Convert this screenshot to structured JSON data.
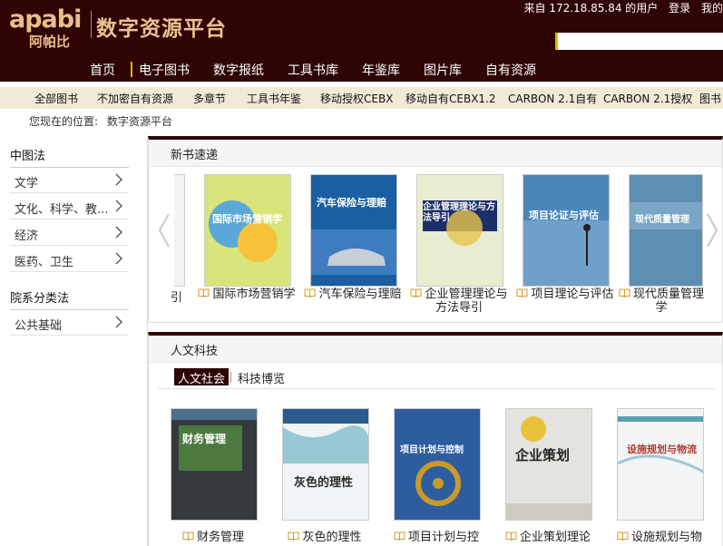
{
  "header": {
    "logo_en": "apabi",
    "logo_cn": "阿帕比",
    "site_title": "数字资源平台",
    "user_text": "来自 172.18.85.84 的用户",
    "login": "登录",
    "mine": "我的",
    "search_value": ""
  },
  "main_nav": [
    "首页",
    "电子图书",
    "数字报纸",
    "工具书库",
    "年鉴库",
    "图片库",
    "自有资源"
  ],
  "sub_nav": [
    "全部图书",
    "不加密自有资源",
    "多章节",
    "工具书年鉴",
    "移动授权CEBX",
    "移动自有CEBX1.2",
    "CARBON 2.1自有",
    "CARBON 2.1授权",
    "图书"
  ],
  "breadcrumb": {
    "label": "您现在的位置:",
    "current": "数字资源平台"
  },
  "sidebar": {
    "heading1": "中图法",
    "items1": [
      "文学",
      "文化、科学、教...",
      "经济",
      "医药、卫生"
    ],
    "heading2": "院系分类法",
    "items2": [
      "公共基础"
    ]
  },
  "new_books": {
    "title": "新书速递",
    "partial_caption": "引",
    "books": [
      {
        "title": "国际市场营销学",
        "cover_text": "国际市场营销学",
        "color": "#d8e57a"
      },
      {
        "title": "汽车保险与理赔",
        "cover_text": "汽车保险与理赔",
        "color": "#1b5fa3"
      },
      {
        "title": "企业管理理论与方法导引",
        "cover_text": "企业管理理论与方法导引",
        "color": "#e9ecd0"
      },
      {
        "title": "项目理论与评估",
        "cover_text": "项目论证与评估",
        "color": "#4a86b9"
      },
      {
        "title": "现代质量管理学",
        "cover_text": "现代质量管理",
        "color": "#5d8fb3"
      }
    ]
  },
  "humanities": {
    "title": "人文科技",
    "tabs": [
      "人文社会",
      "科技博览"
    ],
    "books": [
      {
        "title": "财务管理",
        "cover_text": "财务管理",
        "color": "#343a3e"
      },
      {
        "title": "灰色的理性",
        "cover_text": "灰色的理性",
        "color": "#f1f4f6"
      },
      {
        "title": "项目计划与控",
        "cover_text": "项目计划与控制",
        "color": "#2d5d9e"
      },
      {
        "title": "企业策划理论",
        "cover_text": "企业策划",
        "color": "#e5e3e0"
      },
      {
        "title": "设施规划与物",
        "cover_text": "设施规划与物流",
        "color": "#f2f4f6"
      }
    ]
  }
}
